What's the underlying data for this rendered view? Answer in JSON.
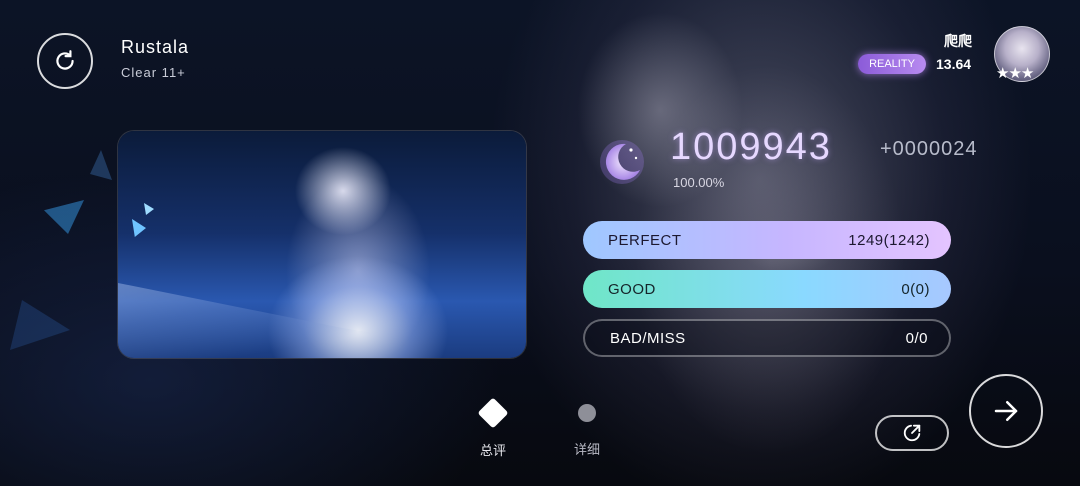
{
  "song": {
    "title": "Rustala",
    "level": "Clear 11+"
  },
  "player": {
    "name": "爬爬",
    "rank_badge": "REALITY",
    "rks": "13.64",
    "stars": "★★★"
  },
  "result": {
    "score": "1009943",
    "score_diff": "+0000024",
    "accuracy": "100.00%"
  },
  "judgements": [
    {
      "label": "PERFECT",
      "value": "1249(1242)"
    },
    {
      "label": "GOOD",
      "value": "0(0)"
    },
    {
      "label": "BAD/MISS",
      "value": "0/0"
    }
  ],
  "tabs": [
    {
      "label": "总评",
      "icon": "diamond-icon"
    },
    {
      "label": "详细",
      "icon": "dot-icon"
    }
  ],
  "icons": {
    "retry": "retry-icon",
    "share": "share-icon",
    "next": "arrow-right-icon",
    "score_emblem": "crescent-moon-icon"
  },
  "colors": {
    "perfect_gradient": [
      "#9fc8ff",
      "#e4c4ff"
    ],
    "good_gradient": [
      "#6fe6c7",
      "#a7c8ff"
    ],
    "rank_badge": "#8b5bd8",
    "score_text": "#e6d8ff"
  }
}
